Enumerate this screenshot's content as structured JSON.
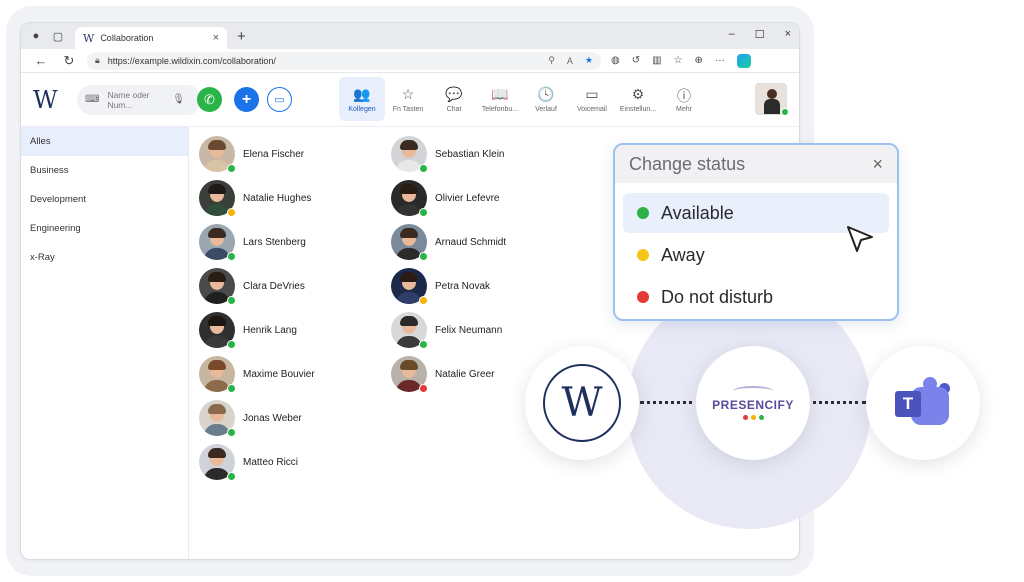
{
  "browser": {
    "tab_title": "Collaboration",
    "tab_close": "×",
    "new_tab": "+",
    "url": "https://example.wildixin.com/collaboration/",
    "window_controls": [
      "–",
      "☐",
      "×"
    ]
  },
  "toolbar": {
    "search_placeholder": "Name oder Num...",
    "nav": [
      {
        "label": "Kollegen",
        "icon": "users-icon",
        "glyph": "👥",
        "active": true
      },
      {
        "label": "Fn Tasten",
        "icon": "star-icon",
        "glyph": "☆",
        "active": false
      },
      {
        "label": "Chat",
        "icon": "chat-icon",
        "glyph": "💬",
        "active": false
      },
      {
        "label": "Telefonbu...",
        "icon": "book-icon",
        "glyph": "📖",
        "active": false
      },
      {
        "label": "Verlauf",
        "icon": "clock-icon",
        "glyph": "🕓",
        "active": false
      },
      {
        "label": "Voicemail",
        "icon": "voicemail-icon",
        "glyph": "▭",
        "active": false
      },
      {
        "label": "Einstellun...",
        "icon": "gear-icon",
        "glyph": "⚙",
        "active": false
      },
      {
        "label": "Mehr",
        "icon": "more-icon",
        "glyph": "ⓘ",
        "active": false
      }
    ]
  },
  "sidebar": {
    "items": [
      {
        "label": "Alles",
        "active": true
      },
      {
        "label": "Business",
        "active": false
      },
      {
        "label": "Development",
        "active": false
      },
      {
        "label": "Engineering",
        "active": false
      },
      {
        "label": "x-Ray",
        "active": false
      }
    ]
  },
  "contacts": {
    "column1": [
      {
        "name": "Elena Fischer",
        "status": "available"
      },
      {
        "name": "Natalie Hughes",
        "status": "away"
      },
      {
        "name": "Lars Stenberg",
        "status": "available"
      },
      {
        "name": "Clara DeVries",
        "status": "available"
      },
      {
        "name": "Henrik Lang",
        "status": "available"
      },
      {
        "name": "Maxime Bouvier",
        "status": "available"
      },
      {
        "name": "Jonas Weber",
        "status": "available"
      },
      {
        "name": "Matteo Ricci",
        "status": "available"
      }
    ],
    "column2": [
      {
        "name": "Sebastian Klein",
        "status": "available"
      },
      {
        "name": "Olivier Lefevre",
        "status": "available"
      },
      {
        "name": "Arnaud Schmidt",
        "status": "available"
      },
      {
        "name": "Petra Novak",
        "status": "away"
      },
      {
        "name": "Felix Neumann",
        "status": "available"
      },
      {
        "name": "Natalie Greer",
        "status": "dnd"
      }
    ]
  },
  "status_colors": {
    "available": "#28b446",
    "away": "#f4b400",
    "dnd": "#e53935"
  },
  "status_popup": {
    "title": "Change status",
    "close": "×",
    "options": [
      {
        "label": "Available",
        "color": "#2db24a",
        "highlighted": true
      },
      {
        "label": "Away",
        "color": "#f5c518",
        "highlighted": false
      },
      {
        "label": "Do not disturb",
        "color": "#e53935",
        "highlighted": false
      }
    ]
  },
  "integration": {
    "presencify_label": "PRESENCIFY",
    "teams_letter": "T"
  }
}
